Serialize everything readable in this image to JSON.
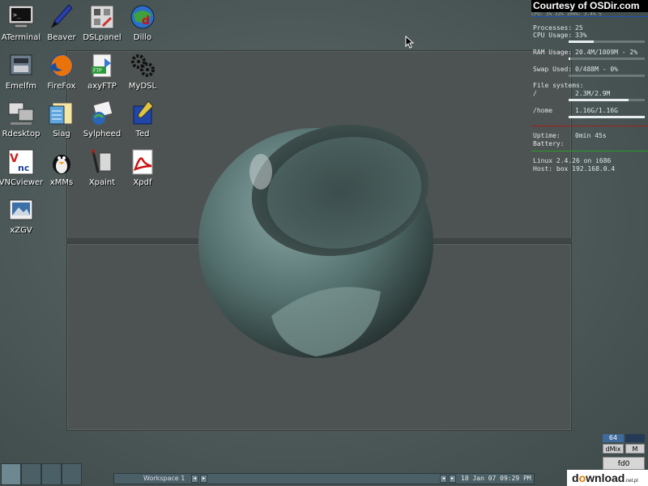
{
  "desktop_icons": [
    {
      "label": "ATerminal",
      "icon": "terminal-icon"
    },
    {
      "label": "Beaver",
      "icon": "pen-brush-icon"
    },
    {
      "label": "DSLpanel",
      "icon": "control-panel-icon"
    },
    {
      "label": "Dillo",
      "icon": "dillo-browser-icon"
    },
    {
      "label": "Emelfm",
      "icon": "file-manager-icon"
    },
    {
      "label": "FireFox",
      "icon": "firefox-icon"
    },
    {
      "label": "axyFTP",
      "icon": "ftp-icon"
    },
    {
      "label": "MyDSL",
      "icon": "gears-icon"
    },
    {
      "label": "Rdesktop",
      "icon": "remote-desktop-icon"
    },
    {
      "label": "Siag",
      "icon": "spreadsheet-icon"
    },
    {
      "label": "Sylpheed",
      "icon": "mail-icon"
    },
    {
      "label": "Ted",
      "icon": "text-editor-icon"
    },
    {
      "label": "VNCviewer",
      "icon": "vnc-icon"
    },
    {
      "label": "xMMs",
      "icon": "media-player-icon"
    },
    {
      "label": "Xpaint",
      "icon": "paint-icon"
    },
    {
      "label": "Xpdf",
      "icon": "pdf-icon"
    },
    {
      "label": "xZGV",
      "icon": "image-viewer-icon"
    }
  ],
  "conky": {
    "banner": "Courtesy of OSDir.com",
    "cpu_line": "CPU: 3% 33% 100%: 3.4% 5",
    "processes_label": "Processes:",
    "processes_value": "25",
    "cpu_label": "CPU Usage:",
    "cpu_value": "33%",
    "cpu_fraction": 0.33,
    "ram_label": "RAM Usage:",
    "ram_value": "20.4M/1009M - 2%",
    "ram_fraction": 0.02,
    "swap_label": "Swap Used:",
    "swap_value": "0/488M - 0%",
    "swap_fraction": 0.0,
    "fs_label": "File systems:",
    "fs_root_label": "/",
    "fs_root_value": "2.3M/2.9M",
    "fs_root_fraction": 0.79,
    "fs_home_label": "/home",
    "fs_home_value": "1.16G/1.16G",
    "fs_home_fraction": 1.0,
    "uptime_label": "Uptime:",
    "uptime_value": "0min 45s",
    "battery_label": "Battery:",
    "kernel_line": "Linux 2.4.26 on i686",
    "host_line": "Host: box 192.168.0.4",
    "rule_colors": [
      "#1e4fb5",
      "#a41c1c",
      "#2b9a2b"
    ]
  },
  "taskbar": {
    "workspace_label": "Workspace 1",
    "clock": "18 Jan 07 09:29 PM"
  },
  "dock": {
    "volume": "64",
    "dmix_label": "dMix",
    "m_label": "M",
    "fd_label": "fd0"
  },
  "watermark": {
    "text_a": "d",
    "text_o": "o",
    "text_b": "wnload",
    "suffix": ".net.pl"
  }
}
